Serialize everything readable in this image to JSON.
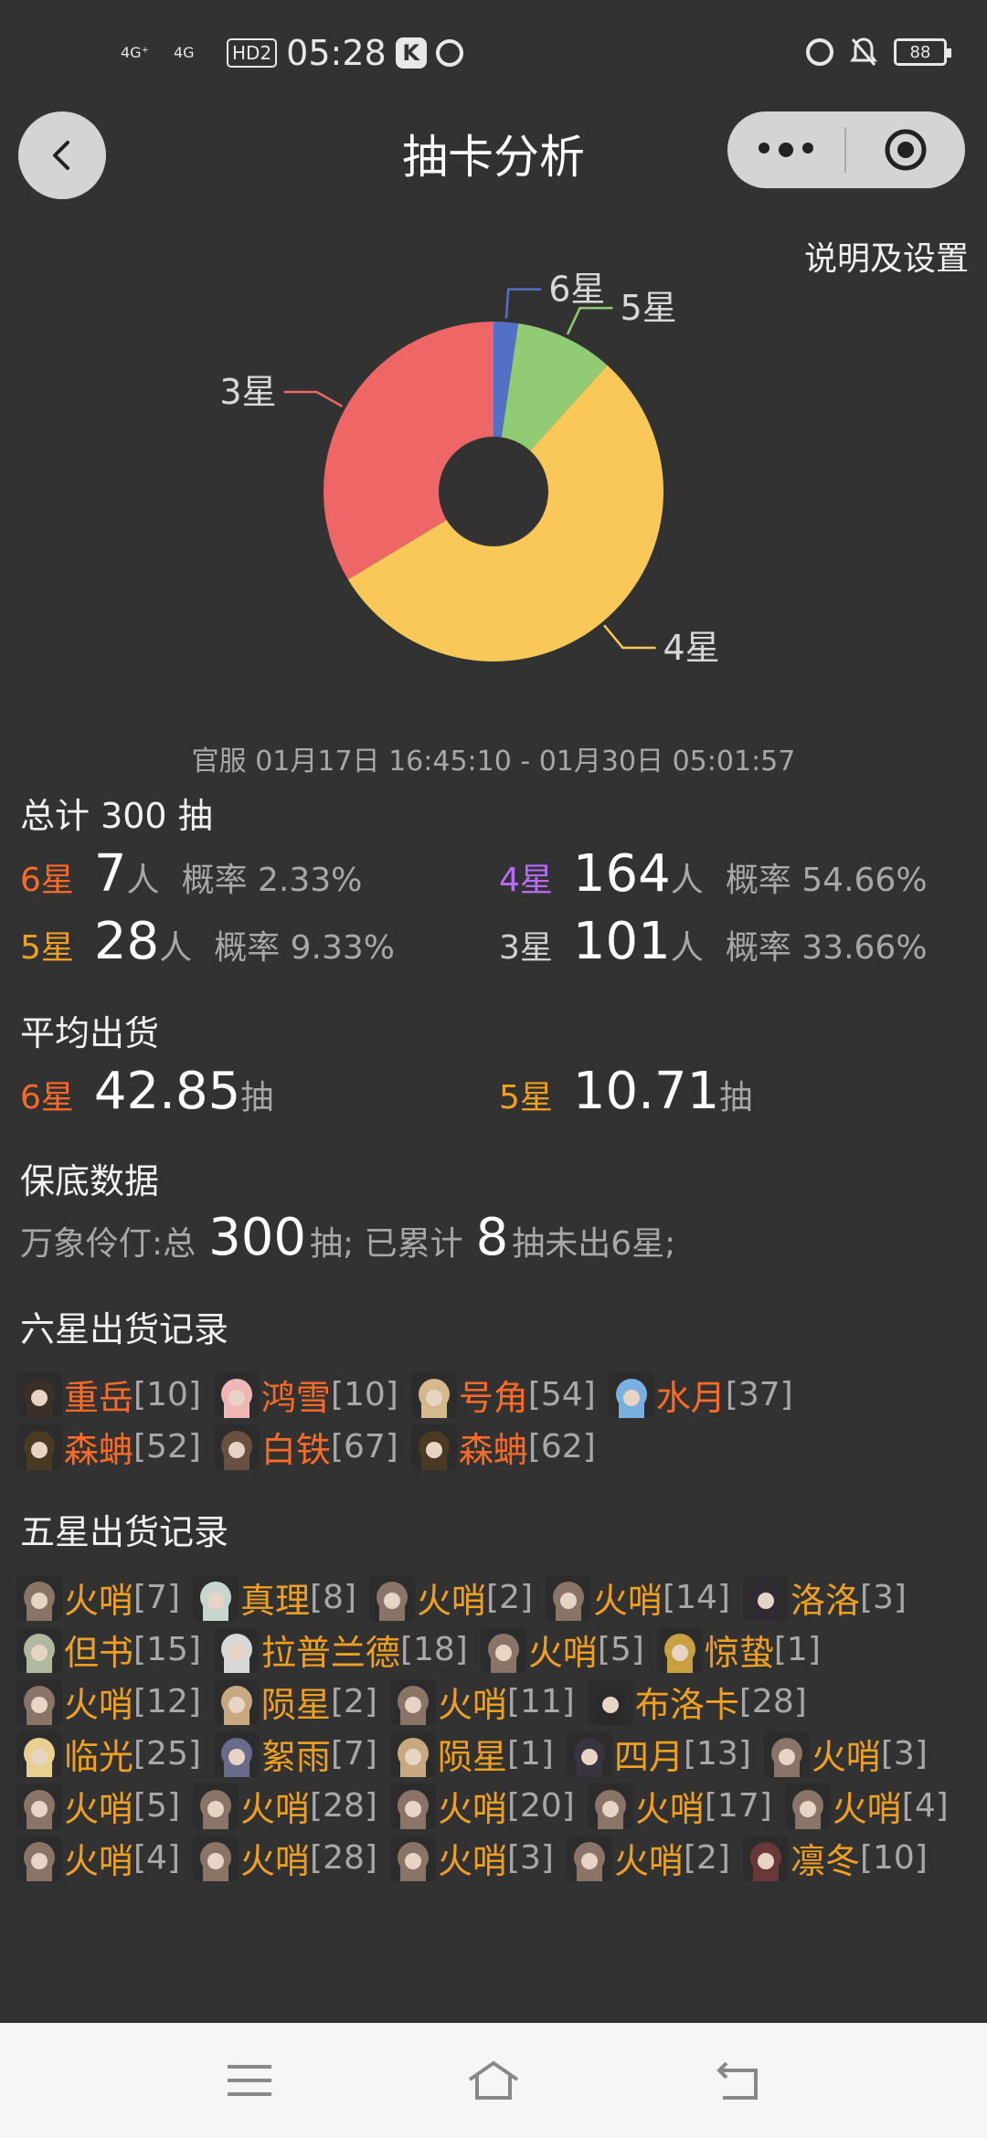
{
  "status_bar": {
    "signal1": "4G⁺",
    "signal2": "4G",
    "hd": "HD2",
    "time": "05:28",
    "app_badge": "K",
    "battery": "88"
  },
  "header": {
    "title": "抽卡分析",
    "settings_link": "说明及设置"
  },
  "chart_data": {
    "type": "pie",
    "categories": [
      "6星",
      "5星",
      "4星",
      "3星"
    ],
    "values": [
      7,
      28,
      164,
      101
    ],
    "colors": [
      "#5470c6",
      "#91cc75",
      "#fac858",
      "#ee6666"
    ],
    "donut": true
  },
  "period": "官服 01月17日 16:45:10 - 01月30日 05:01:57",
  "summary": {
    "total_title": "总计 300 抽",
    "six": {
      "label": "6星",
      "count": "7",
      "unit": "人",
      "prob": "概率 2.33%"
    },
    "five": {
      "label": "5星",
      "count": "28",
      "unit": "人",
      "prob": "概率 9.33%"
    },
    "four": {
      "label": "4星",
      "count": "164",
      "unit": "人",
      "prob": "概率 54.66%"
    },
    "three": {
      "label": "3星",
      "count": "101",
      "unit": "人",
      "prob": "概率 33.66%"
    }
  },
  "average": {
    "title": "平均出货",
    "six_label": "6星",
    "six_value": "42.85",
    "five_label": "5星",
    "five_value": "10.71",
    "unit": "抽"
  },
  "pity": {
    "title": "保底数据",
    "prefix": "万象伶仃:总",
    "total": "300",
    "mid": "抽; 已累计",
    "accum": "8",
    "suffix": "抽未出6星;"
  },
  "six_records": {
    "title": "六星出货记录",
    "items": [
      {
        "name": "重岳",
        "count": "[10]",
        "avatar": "#3a3028"
      },
      {
        "name": "鸿雪",
        "count": "[10]",
        "avatar": "#f0b6b6"
      },
      {
        "name": "号角",
        "count": "[54]",
        "avatar": "#d4b98a"
      },
      {
        "name": "水月",
        "count": "[37]",
        "avatar": "#7ab0e0"
      },
      {
        "name": "森蚺",
        "count": "[52]",
        "avatar": "#4a3a22"
      },
      {
        "name": "白铁",
        "count": "[67]",
        "avatar": "#6a5040"
      },
      {
        "name": "森蚺",
        "count": "[62]",
        "avatar": "#4a3a22"
      }
    ]
  },
  "five_records": {
    "title": "五星出货记录",
    "items": [
      {
        "name": "火哨",
        "count": "[7]",
        "avatar": "#8a7468"
      },
      {
        "name": "真理",
        "count": "[8]",
        "avatar": "#c9d6d0"
      },
      {
        "name": "火哨",
        "count": "[2]",
        "avatar": "#8a7468"
      },
      {
        "name": "火哨",
        "count": "[14]",
        "avatar": "#8a7468"
      },
      {
        "name": "洛洛",
        "count": "[3]",
        "avatar": "#2e2a34"
      },
      {
        "name": "但书",
        "count": "[15]",
        "avatar": "#b0b8a0"
      },
      {
        "name": "拉普兰德",
        "count": "[18]",
        "avatar": "#d8d8d8"
      },
      {
        "name": "火哨",
        "count": "[5]",
        "avatar": "#8a7468"
      },
      {
        "name": "惊蛰",
        "count": "[1]",
        "avatar": "#c8a040"
      },
      {
        "name": "火哨",
        "count": "[12]",
        "avatar": "#8a7468"
      },
      {
        "name": "陨星",
        "count": "[2]",
        "avatar": "#c8a880"
      },
      {
        "name": "火哨",
        "count": "[11]",
        "avatar": "#8a7468"
      },
      {
        "name": "布洛卡",
        "count": "[28]",
        "avatar": "#2a2a2a"
      },
      {
        "name": "临光",
        "count": "[25]",
        "avatar": "#e8d090"
      },
      {
        "name": "絮雨",
        "count": "[7]",
        "avatar": "#6a6a8a"
      },
      {
        "name": "陨星",
        "count": "[1]",
        "avatar": "#c8a880"
      },
      {
        "name": "四月",
        "count": "[13]",
        "avatar": "#3a3440"
      },
      {
        "name": "火哨",
        "count": "[3]",
        "avatar": "#8a7468"
      },
      {
        "name": "火哨",
        "count": "[5]",
        "avatar": "#8a7468"
      },
      {
        "name": "火哨",
        "count": "[28]",
        "avatar": "#8a7468"
      },
      {
        "name": "火哨",
        "count": "[20]",
        "avatar": "#8a7468"
      },
      {
        "name": "火哨",
        "count": "[17]",
        "avatar": "#8a7468"
      },
      {
        "name": "火哨",
        "count": "[4]",
        "avatar": "#8a7468"
      },
      {
        "name": "火哨",
        "count": "[4]",
        "avatar": "#8a7468"
      },
      {
        "name": "火哨",
        "count": "[28]",
        "avatar": "#8a7468"
      },
      {
        "name": "火哨",
        "count": "[3]",
        "avatar": "#8a7468"
      },
      {
        "name": "火哨",
        "count": "[2]",
        "avatar": "#8a7468"
      },
      {
        "name": "凛冬",
        "count": "[10]",
        "avatar": "#6a3838"
      }
    ]
  }
}
